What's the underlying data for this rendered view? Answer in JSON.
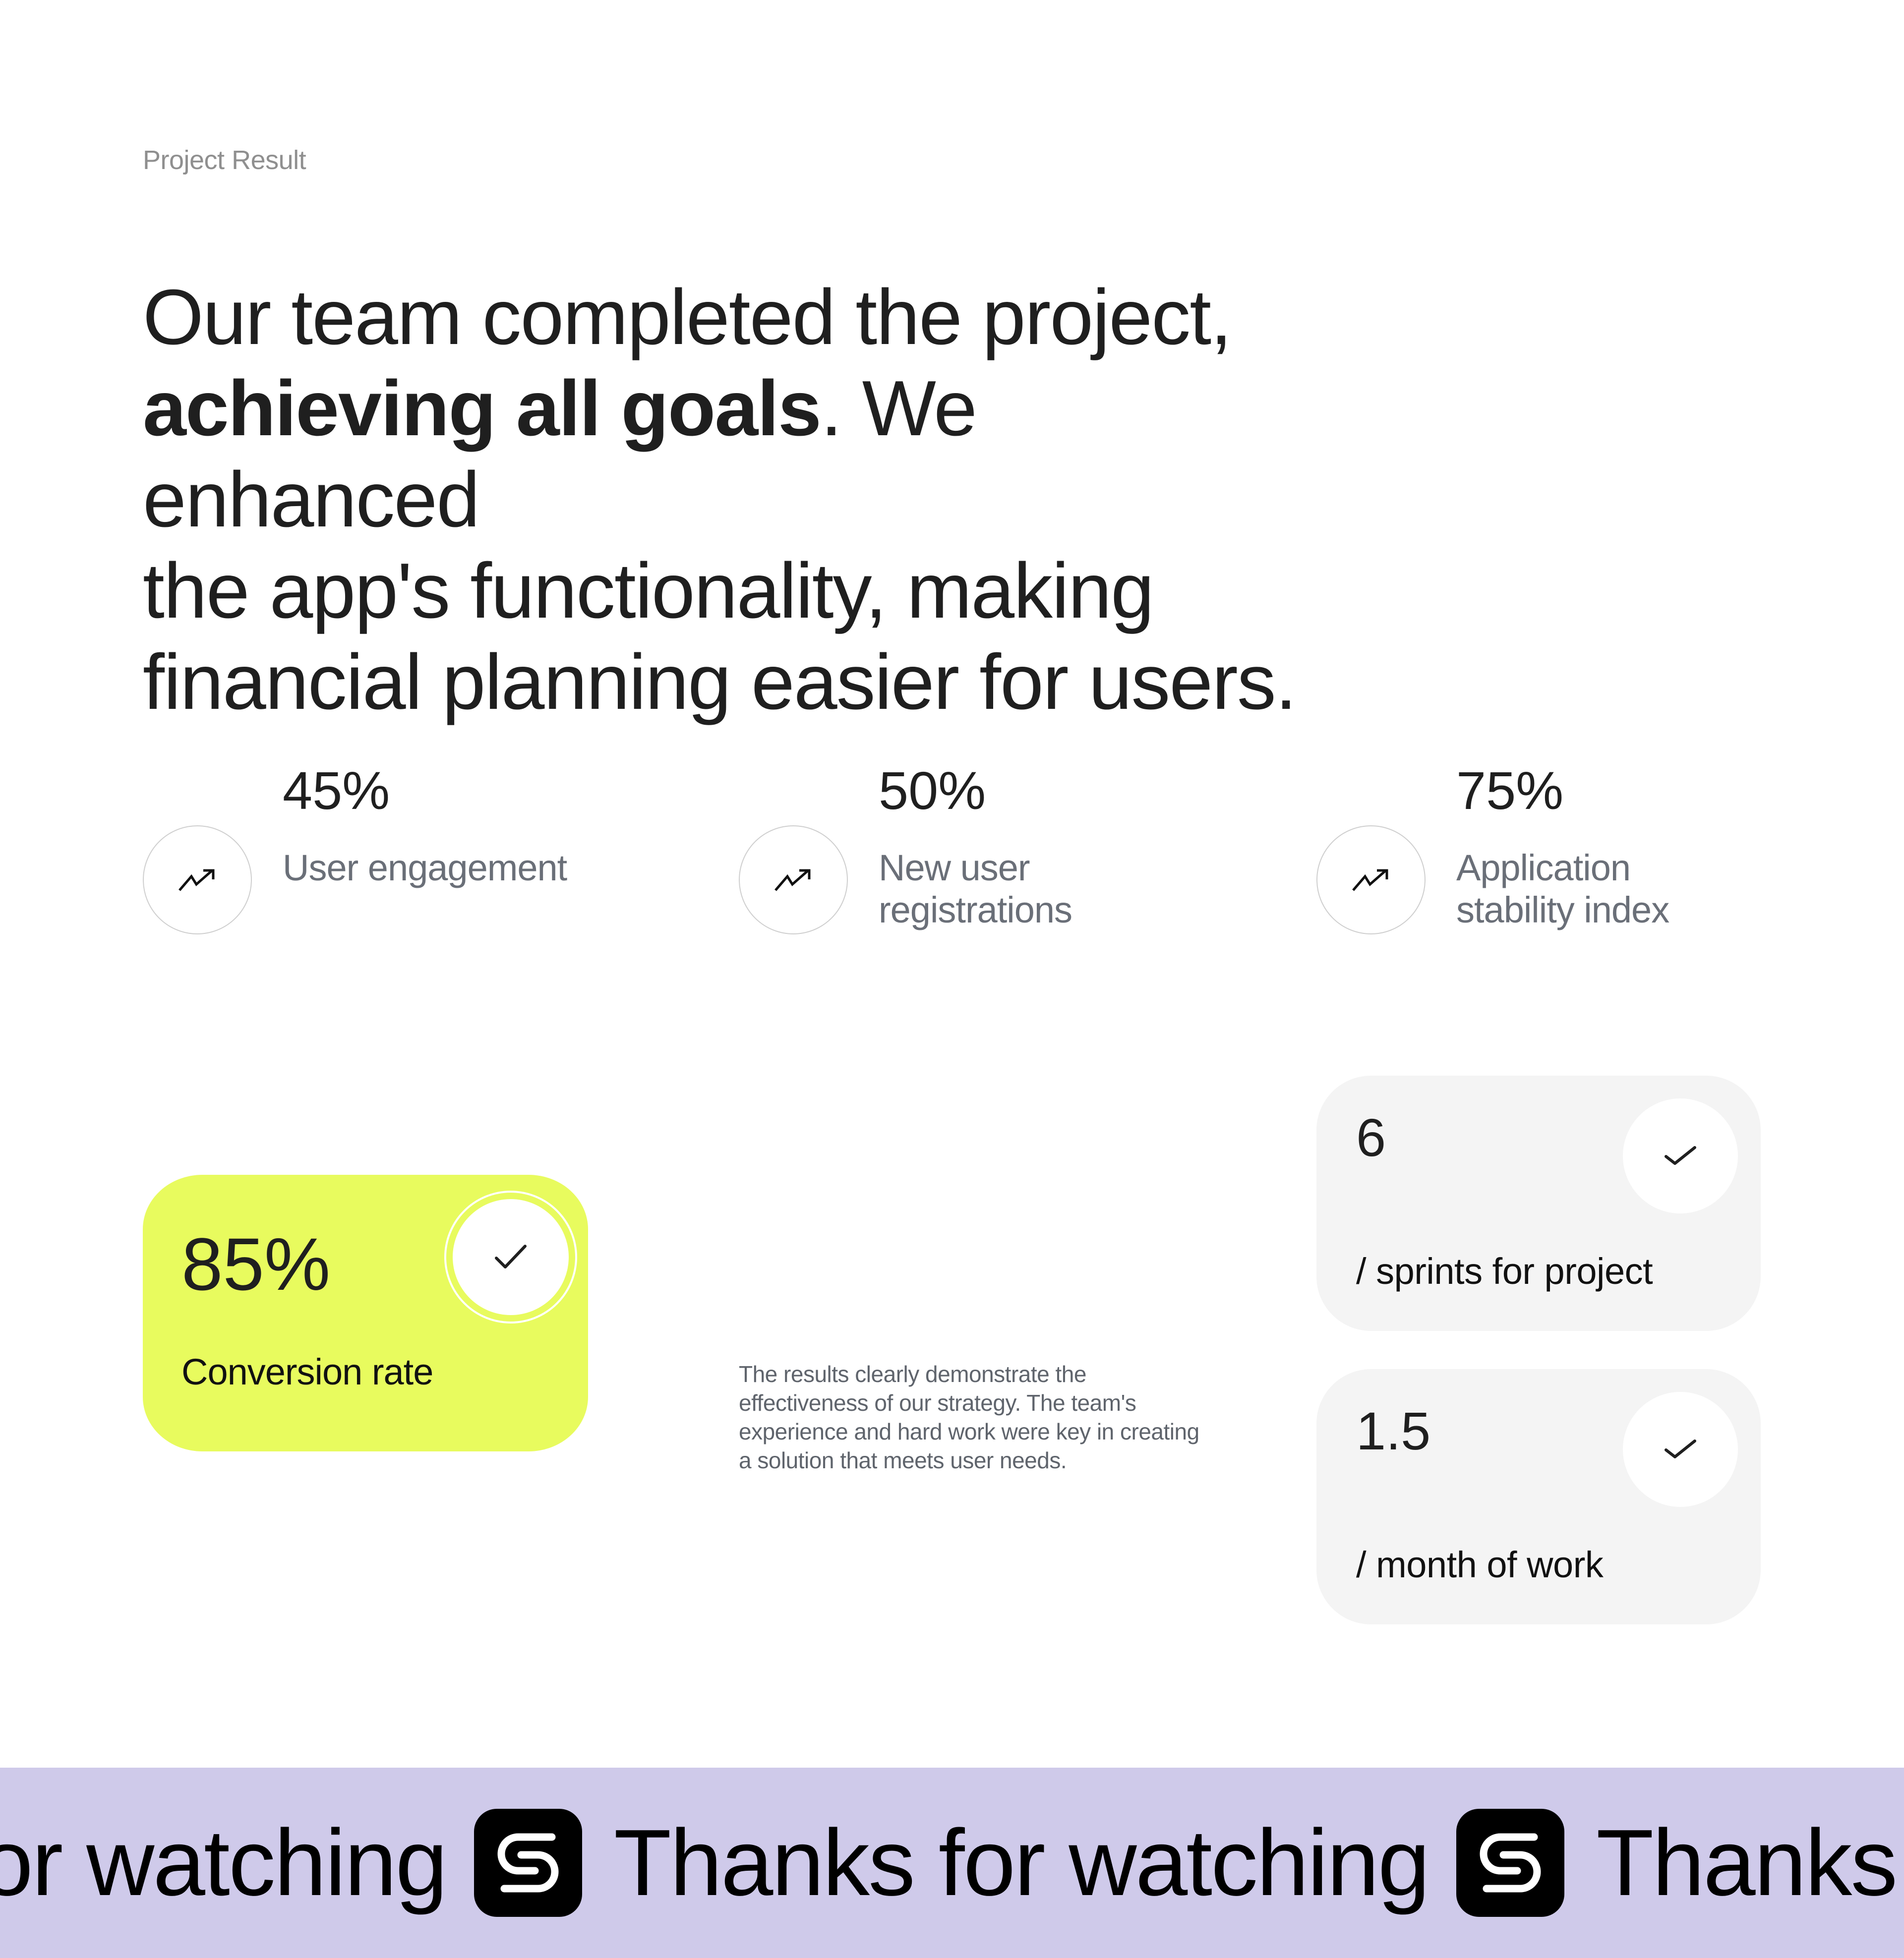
{
  "eyebrow": "Project Result",
  "headline": {
    "line1": "Our team completed the project,",
    "bold": "achieving all goals",
    "after_bold": ". We enhanced",
    "line3": "the app's functionality, making",
    "line4": "financial planning easier for users."
  },
  "stats": [
    {
      "value": "45%",
      "label": "User engagement",
      "icon": "trending-up-icon"
    },
    {
      "value": "50%",
      "label": "New user registrations",
      "icon": "trending-up-icon"
    },
    {
      "value": "75%",
      "label": "Application stability index",
      "icon": "trending-up-icon"
    }
  ],
  "highlight_card": {
    "value": "85%",
    "label": "Conversion rate",
    "icon": "check-icon",
    "color": "#e8fb5e"
  },
  "blurb": "The results clearly demonstrate the effectiveness of our strategy. The team's experience and hard work were key in creating a solution that meets user needs.",
  "metric_cards": [
    {
      "value": "6",
      "label": "/ sprints for project",
      "icon": "check-icon"
    },
    {
      "value": "1.5",
      "label": "/ month of work",
      "icon": "check-icon"
    }
  ],
  "banner": {
    "phrases": [
      "Thanks for watching",
      "Thanks for watching",
      "Thanks for watching"
    ],
    "logo_icon": "s-logo-icon",
    "background": "#cfcaea"
  }
}
